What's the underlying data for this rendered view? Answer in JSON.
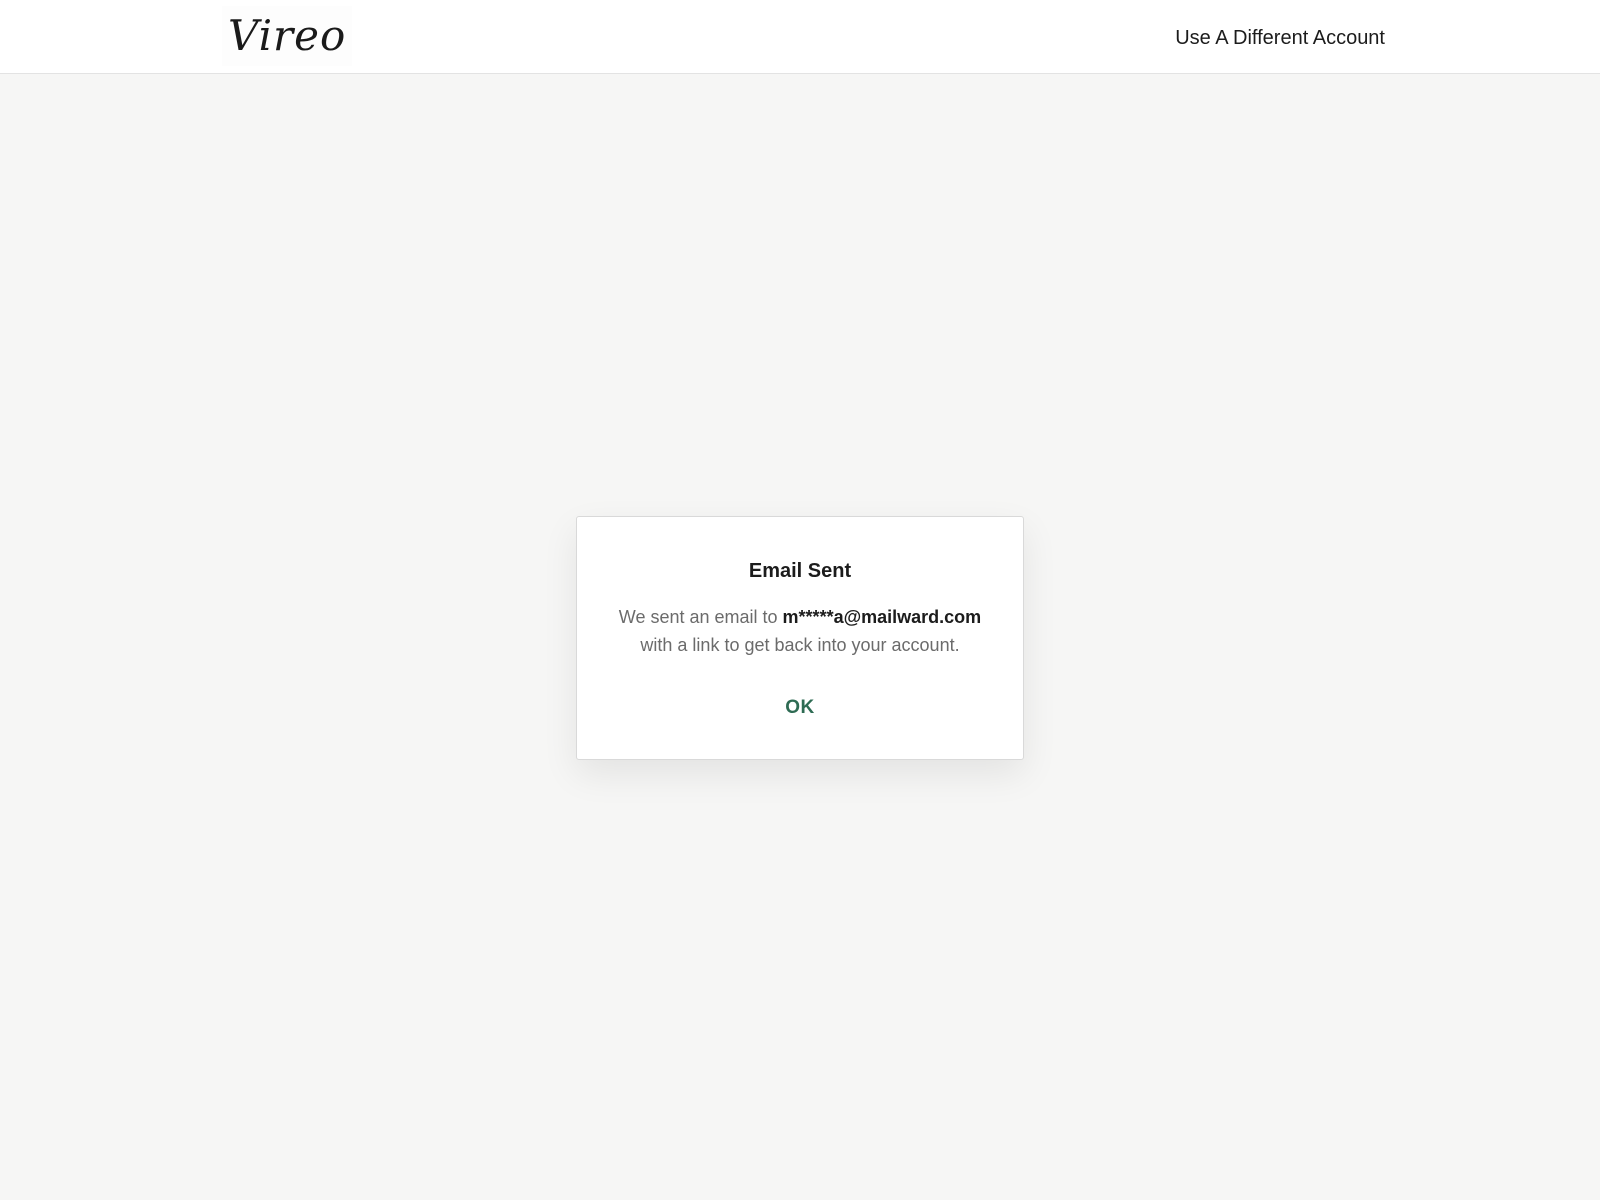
{
  "header": {
    "logo_text": "Vireo",
    "alt_account_label": "Use A Different Account"
  },
  "dialog": {
    "title": "Email Sent",
    "message_prefix": "We sent an email to ",
    "email": "m*****a@mailward.com",
    "message_suffix": "with a link to get back into your account.",
    "ok_label": "OK"
  },
  "colors": {
    "accent": "#2e6b53",
    "background": "#f6f6f5"
  }
}
